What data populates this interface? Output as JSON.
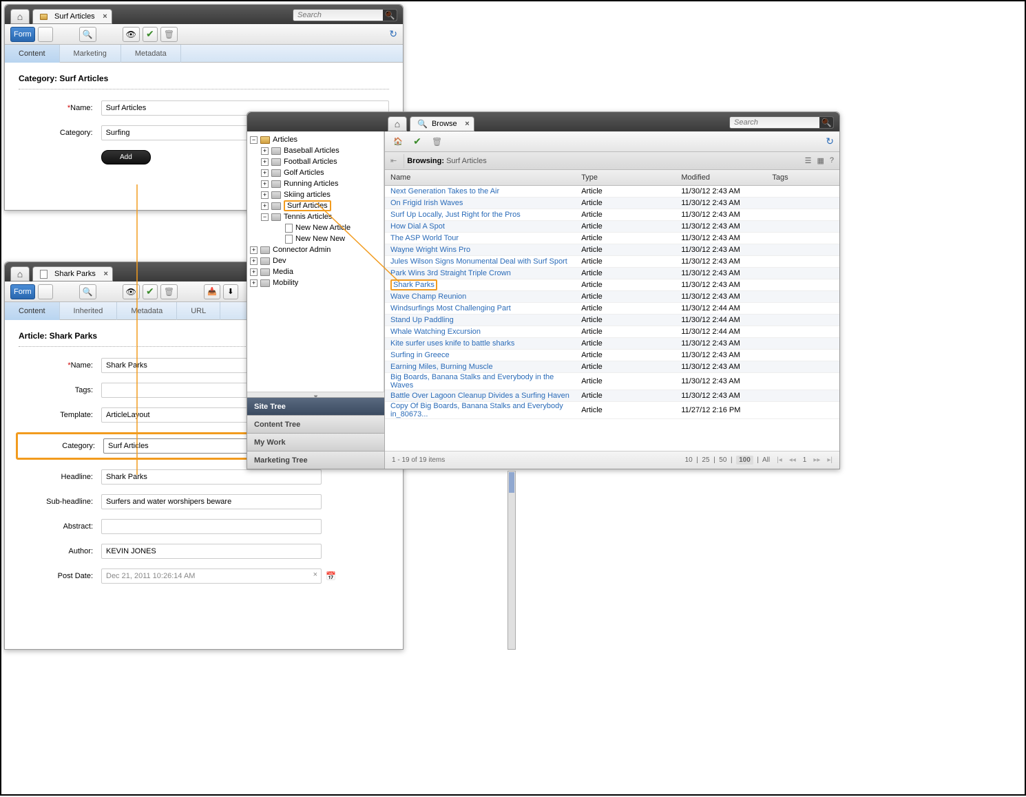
{
  "win1": {
    "tab_title": "Surf Articles",
    "search_placeholder": "Search",
    "toolbar": {
      "form": "Form"
    },
    "subtabs": [
      "Content",
      "Marketing",
      "Metadata"
    ],
    "section_title": "Category:  Surf Articles",
    "labels": {
      "name": "Name:",
      "category": "Category:"
    },
    "values": {
      "name": "Surf Articles",
      "category": "Surfing"
    },
    "add": "Add"
  },
  "win2": {
    "tab_title": "Shark Parks",
    "toolbar": {
      "form": "Form"
    },
    "subtabs": [
      "Content",
      "Inherited",
      "Metadata",
      "URL"
    ],
    "section_title": "Article: Shark Parks",
    "labels": {
      "name": "Name:",
      "tags": "Tags:",
      "template": "Template:",
      "category": "Category:",
      "headline": "Headline:",
      "subheadline": "Sub-headline:",
      "abstract": "Abstract:",
      "author": "Author:",
      "postdate": "Post Date:"
    },
    "values": {
      "name": "Shark Parks",
      "tags": "",
      "template": "ArticleLayout",
      "category": "Surf Articles",
      "headline": "Shark Parks",
      "subheadline": "Surfers and water worshipers beware",
      "abstract": "",
      "author": "KEVIN JONES",
      "postdate": "Dec 21, 2011 10:26:14 AM"
    }
  },
  "win3": {
    "tab_title": "Browse",
    "search_placeholder": "Search",
    "breadcrumb_label": "Browsing:",
    "breadcrumb_value": "Surf Articles",
    "side_trees": [
      "Site Tree",
      "Content Tree",
      "My Work",
      "Marketing Tree"
    ],
    "tree": {
      "root": "Articles",
      "children": [
        "Baseball Articles",
        "Football Articles",
        "Golf Articles",
        "Running Articles",
        "Skiing articles",
        "Surf Articles",
        "Tennis Articles"
      ],
      "tennis_children": [
        "New New Article",
        "New New New"
      ],
      "after": [
        "Connector Admin",
        "Dev",
        "Media",
        "Mobility"
      ]
    },
    "columns": [
      "Name",
      "Type",
      "Modified",
      "Tags"
    ],
    "rows": [
      {
        "name": "Next Generation Takes to the Air",
        "type": "Article",
        "modified": "11/30/12 2:43 AM"
      },
      {
        "name": "On Frigid Irish Waves",
        "type": "Article",
        "modified": "11/30/12 2:43 AM"
      },
      {
        "name": "Surf Up Locally, Just Right for the Pros",
        "type": "Article",
        "modified": "11/30/12 2:43 AM"
      },
      {
        "name": "How Dial A Spot",
        "type": "Article",
        "modified": "11/30/12 2:43 AM"
      },
      {
        "name": "The ASP World Tour",
        "type": "Article",
        "modified": "11/30/12 2:43 AM"
      },
      {
        "name": "Wayne Wright Wins Pro",
        "type": "Article",
        "modified": "11/30/12 2:43 AM"
      },
      {
        "name": "Jules Wilson Signs Monumental Deal with Surf Sport",
        "type": "Article",
        "modified": "11/30/12 2:43 AM"
      },
      {
        "name": "Park Wins 3rd Straight Triple Crown",
        "type": "Article",
        "modified": "11/30/12 2:43 AM"
      },
      {
        "name": "Shark Parks",
        "type": "Article",
        "modified": "11/30/12 2:43 AM",
        "hl": true
      },
      {
        "name": "Wave Champ Reunion",
        "type": "Article",
        "modified": "11/30/12 2:43 AM"
      },
      {
        "name": "Windsurfings Most Challenging Part",
        "type": "Article",
        "modified": "11/30/12 2:44 AM"
      },
      {
        "name": "Stand Up Paddling",
        "type": "Article",
        "modified": "11/30/12 2:44 AM"
      },
      {
        "name": "Whale Watching Excursion",
        "type": "Article",
        "modified": "11/30/12 2:44 AM"
      },
      {
        "name": "Kite surfer uses knife to battle sharks",
        "type": "Article",
        "modified": "11/30/12 2:43 AM"
      },
      {
        "name": "Surfing in Greece",
        "type": "Article",
        "modified": "11/30/12 2:43 AM"
      },
      {
        "name": "Earning Miles, Burning Muscle",
        "type": "Article",
        "modified": "11/30/12 2:43 AM"
      },
      {
        "name": "Big Boards, Banana Stalks and Everybody in the Waves",
        "type": "Article",
        "modified": "11/30/12 2:43 AM"
      },
      {
        "name": "Battle Over Lagoon Cleanup Divides a Surfing Haven",
        "type": "Article",
        "modified": "11/30/12 2:43 AM"
      },
      {
        "name": "Copy Of Big Boards, Banana Stalks and Everybody in_80673...",
        "type": "Article",
        "modified": "11/27/12 2:16 PM"
      }
    ],
    "pager_left": "1 - 19 of 19 items",
    "pager_sizes": [
      "10",
      "25",
      "50",
      "100",
      "All"
    ],
    "pager_page": "1"
  }
}
